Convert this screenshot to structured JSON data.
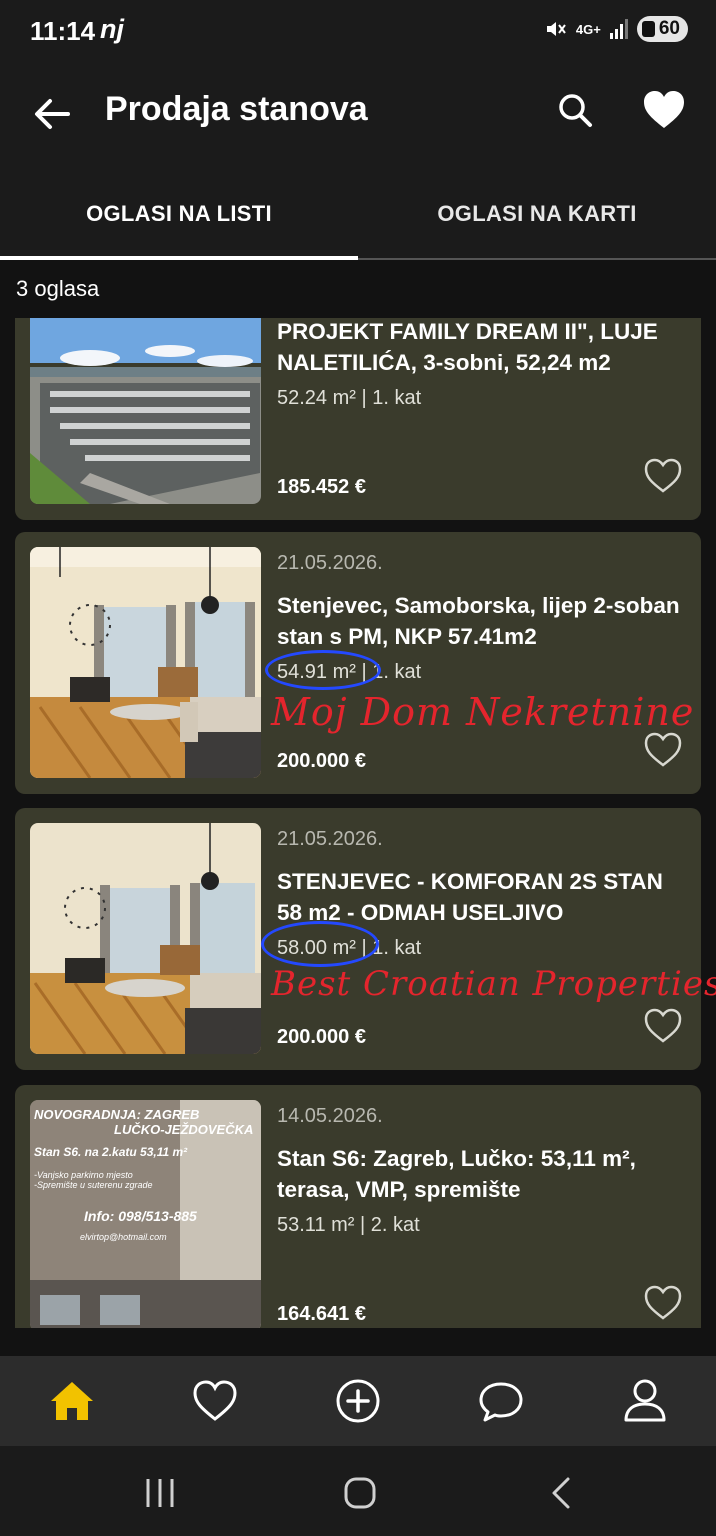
{
  "status_bar": {
    "time": "11:14",
    "carrier": "nj",
    "network": "4G+",
    "battery": "60"
  },
  "app_bar": {
    "title": "Prodaja stanova"
  },
  "tabs": [
    {
      "label": "OGLASI NA LISTI",
      "active": true
    },
    {
      "label": "OGLASI NA KARTI",
      "active": false
    }
  ],
  "listing_count": "3 oglasa",
  "listings": [
    {
      "date": "",
      "title": "PROJEKT FAMILY DREAM II\", LUJE NALETILIĆA, 3-sobni, 52,24 m2",
      "area": "52.24 m²",
      "separator": "|",
      "floor": "1. kat",
      "price": "185.452 €",
      "annotation": ""
    },
    {
      "date": "21.05.2026.",
      "title": "Stenjevec, Samoborska, lijep 2-soban stan s PM, NKP 57.41m2",
      "area": "54.91 m²",
      "separator": "|",
      "floor": "1. kat",
      "price": "200.000 €",
      "annotation": "Moj Dom Nekretnine"
    },
    {
      "date": "21.05.2026.",
      "title": "STENJEVEC - KOMFORAN 2S STAN 58 m2 - ODMAH USELJIVO",
      "area": "58.00 m²",
      "separator": "|",
      "floor": "1. kat",
      "price": "200.000 €",
      "annotation": "Best Croatian Properties"
    },
    {
      "date": "14.05.2026.",
      "title": "Stan S6: Zagreb, Lučko: 53,11 m², terasa, VMP, spremište",
      "area": "53.11 m²",
      "separator": "|",
      "floor": "2. kat",
      "price": "164.641 €",
      "annotation": ""
    }
  ],
  "listing_4_image_text": {
    "line1": "NOVOGRADNJA: ZAGREB",
    "line2": "LUČKO-JEŽDOVEČKA",
    "line3": "Stan S6. na 2.katu 53,11 m²",
    "line4": "-Vanjsko parkirno mjesto",
    "line5": "-Spremište u suterenu zgrade",
    "line6": "Info: 098/513-885",
    "line7": "elvirtop@hotmail.com"
  },
  "bottom_nav": [
    "home-icon",
    "heart-icon",
    "plus-circle-icon",
    "chat-icon",
    "profile-icon"
  ],
  "colors": {
    "accent": "#f2c200",
    "card_bg": "#3a3b2c",
    "handwriting": "#e4252d",
    "circle": "#2449ff"
  }
}
